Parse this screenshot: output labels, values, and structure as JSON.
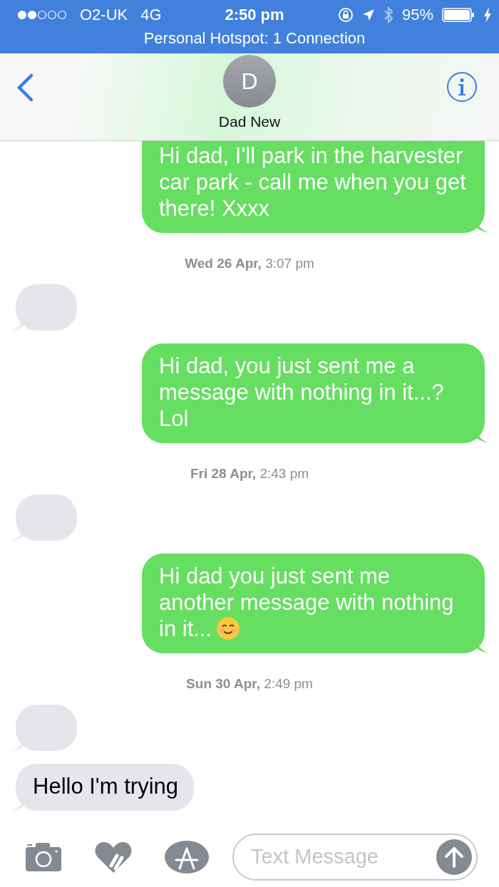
{
  "status_bar": {
    "carrier": "O2-UK",
    "network": "4G",
    "time": "2:50 pm",
    "battery": "95%",
    "hotspot": "Personal Hotspot: 1 Connection"
  },
  "contact": {
    "initial": "D",
    "name": "Dad New"
  },
  "messages": [
    {
      "kind": "sent",
      "text": "Hi dad, I'll park in the harvester car park - call me when you get there! Xxxx"
    },
    {
      "kind": "timestamp",
      "text": "**Wed 26 Apr,** 3:07 pm"
    },
    {
      "kind": "empty"
    },
    {
      "kind": "sent",
      "text": "Hi dad, you just sent me a message with nothing in it...? Lol"
    },
    {
      "kind": "timestamp",
      "text": "**Fri 28 Apr,** 2:43 pm"
    },
    {
      "kind": "empty"
    },
    {
      "kind": "sent",
      "text": "Hi dad you just sent me another message with nothing in it...",
      "emoji": true
    },
    {
      "kind": "timestamp",
      "text": "**Sun 30 Apr,** 2:49 pm"
    },
    {
      "kind": "empty"
    },
    {
      "kind": "received",
      "text": "Hello I'm trying"
    }
  ],
  "composer": {
    "placeholder": "Text Message"
  }
}
